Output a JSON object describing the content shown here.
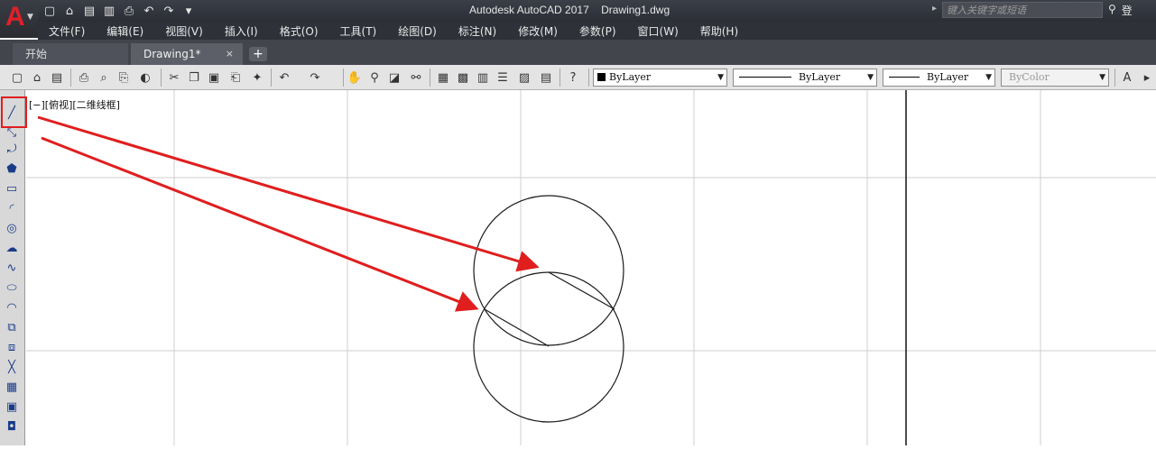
{
  "app": {
    "logo_letter": "A",
    "title": "Autodesk AutoCAD 2017    Drawing1.dwg",
    "search_placeholder": "键入关键字或短语",
    "user_text": "登"
  },
  "quick_access": [
    "new-icon",
    "open-icon",
    "save-icon",
    "saveas-icon",
    "print-icon",
    "undo-icon",
    "redo-icon",
    "dropdown-icon"
  ],
  "menu": [
    "文件(F)",
    "编辑(E)",
    "视图(V)",
    "插入(I)",
    "格式(O)",
    "工具(T)",
    "绘图(D)",
    "标注(N)",
    "修改(M)",
    "参数(P)",
    "窗口(W)",
    "帮助(H)"
  ],
  "tabs": {
    "start": "开始",
    "drawing": "Drawing1*",
    "close": "×",
    "add": "+"
  },
  "toolbar": {
    "color_combo": "ByLayer",
    "linetype_combo": "ByLayer",
    "lineweight_combo": "ByLayer",
    "plotstyle_combo": "ByColor"
  },
  "viewport_label": "[−][俯视][二维线框]",
  "colors": {
    "annotation_red": "#e01e1e",
    "grid": "#c8c8c8",
    "geometry": "#1a1a1a"
  }
}
